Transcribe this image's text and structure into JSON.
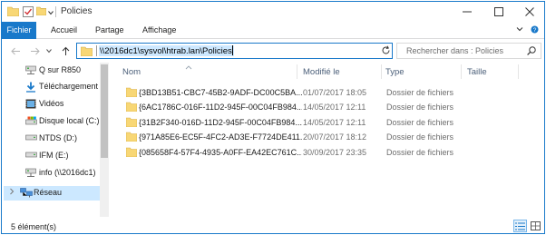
{
  "window": {
    "title": "Policies"
  },
  "ribbon": {
    "tabs": [
      "Fichier",
      "Accueil",
      "Partage",
      "Affichage"
    ]
  },
  "address": {
    "path": "\\\\2016dc1\\sysvol\\htrab.lan\\Policies",
    "search_placeholder": "Rechercher dans : Policies"
  },
  "sidebar": {
    "items": [
      {
        "label": "Q sur R850",
        "icon": "network-drive-icon"
      },
      {
        "label": "Téléchargement",
        "icon": "download-icon"
      },
      {
        "label": "Vidéos",
        "icon": "video-icon"
      },
      {
        "label": "Disque local (C:)",
        "icon": "local-disk-icon"
      },
      {
        "label": "NTDS (D:)",
        "icon": "drive-icon"
      },
      {
        "label": "IFM (E:)",
        "icon": "drive-icon"
      },
      {
        "label": "info (\\\\2016dc1)",
        "icon": "network-drive-icon"
      },
      {
        "label": "Réseau",
        "icon": "network-icon",
        "selected": true
      }
    ]
  },
  "columns": {
    "name": "Nom",
    "modified": "Modifié le",
    "type": "Type",
    "size": "Taille"
  },
  "files": [
    {
      "name": "{3BD13B51-CBC7-45B2-9ADF-DC00C5BA...",
      "modified": "01/07/2017 18:05",
      "type": "Dossier de fichiers"
    },
    {
      "name": "{6AC1786C-016F-11D2-945F-00C04FB984...",
      "modified": "14/05/2017 12:11",
      "type": "Dossier de fichiers"
    },
    {
      "name": "{31B2F340-016D-11D2-945F-00C04FB984...",
      "modified": "14/05/2017 12:11",
      "type": "Dossier de fichiers"
    },
    {
      "name": "{971A85E6-EC5F-4FC2-AD3E-F7724DE411...",
      "modified": "20/07/2017 18:12",
      "type": "Dossier de fichiers"
    },
    {
      "name": "{085658F4-57F4-4935-A0FF-EA42EC761C...",
      "modified": "30/09/2017 23:35",
      "type": "Dossier de fichiers"
    }
  ],
  "status": {
    "count": "5 élément(s)"
  },
  "colors": {
    "accent": "#1979ca",
    "folder": "#f8d775",
    "selection": "#cce8ff"
  }
}
